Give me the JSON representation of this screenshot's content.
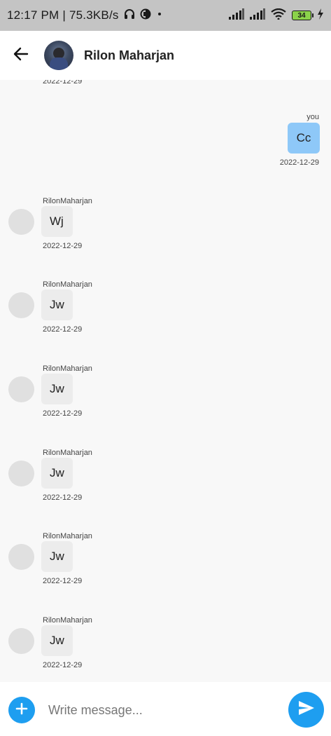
{
  "status_bar": {
    "time": "12:17 PM",
    "speed": "75.3KB/s",
    "separator": "|",
    "battery_level": "34",
    "icons": [
      "headphones-icon",
      "data-saver-icon",
      "dot-icon",
      "signal-icon",
      "signal-icon",
      "wifi-icon",
      "battery-icon",
      "charging-icon"
    ]
  },
  "header": {
    "contact_name": "Rilon Maharjan",
    "back_icon": "arrow-left-icon"
  },
  "top_date": "2022-12-29",
  "outgoing": [
    {
      "sender": "you",
      "text": "Cc",
      "date": "2022-12-29"
    }
  ],
  "incoming": [
    {
      "sender": "RilonMaharjan",
      "text": "Wj",
      "date": "2022-12-29"
    },
    {
      "sender": "RilonMaharjan",
      "text": "Jw",
      "date": "2022-12-29"
    },
    {
      "sender": "RilonMaharjan",
      "text": "Jw",
      "date": "2022-12-29"
    },
    {
      "sender": "RilonMaharjan",
      "text": "Jw",
      "date": "2022-12-29"
    },
    {
      "sender": "RilonMaharjan",
      "text": "Jw",
      "date": "2022-12-29"
    },
    {
      "sender": "RilonMaharjan",
      "text": "Jw",
      "date": "2022-12-29"
    }
  ],
  "composer": {
    "placeholder": "Write message...",
    "value": "",
    "add_icon": "plus-icon",
    "send_icon": "send-icon"
  },
  "colors": {
    "accent": "#1e9ef0",
    "outgoing_bubble": "#8ec8f8",
    "incoming_bubble": "#ececec",
    "status_bar": "#c4c4c4",
    "battery_fill": "#8bd24a"
  }
}
